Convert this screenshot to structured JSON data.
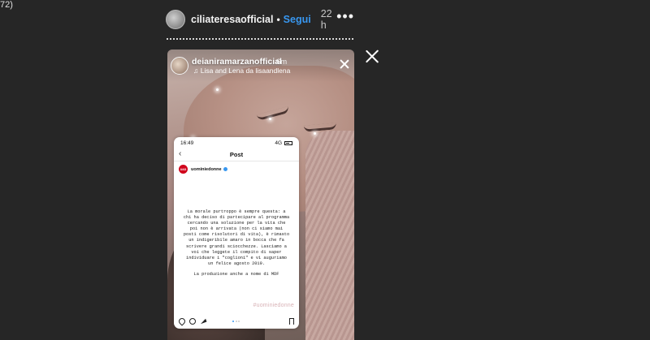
{
  "corner_label": "72)",
  "viewer": {
    "username": "ciliateresaofficial",
    "separator": "•",
    "follow": "Segui",
    "time": "22 h",
    "more": "•••"
  },
  "story": {
    "username": "deianiramarzanofficial",
    "time": "6m",
    "music": "♫ Lisa and Lena da lisaandlena"
  },
  "post": {
    "status_time": "16:49",
    "status_network": "4G",
    "nav_back": "‹",
    "nav_title": "Post",
    "author": "uominiedonne",
    "author_logo": "U&D",
    "body": "La morale purtroppo è sempre questa: a chi ha deciso di partecipare al programma cercando una soluzione per la vita che poi non è arrivata (non ci siamo mai posti come risolutori di vita), è rimasto un indigeribile amaro in bocca che fa scrivere grandi sciocchezze. Lasciamo a voi che leggete il compito di saper individuare i \"coglioni\" e vi auguriamo un felice agosto 2019.",
    "signature": "La produzione anche a nome di MDF",
    "hashtag": "#uominiedonne"
  }
}
